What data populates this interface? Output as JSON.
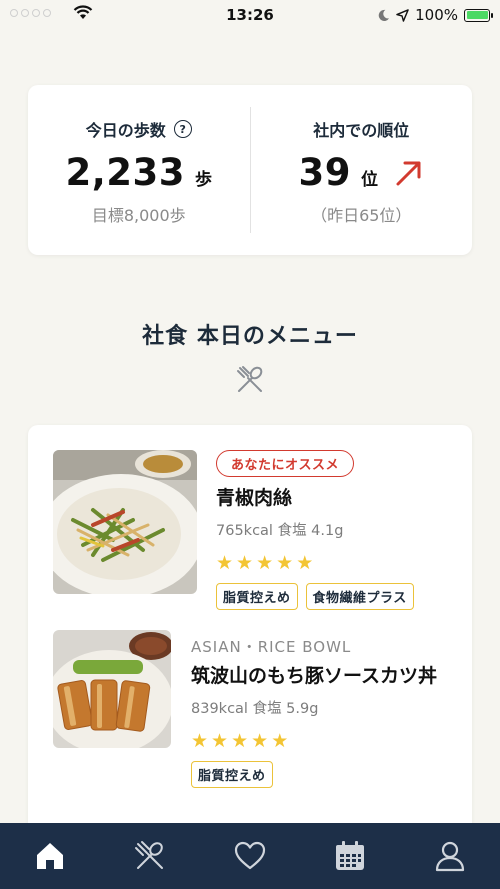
{
  "status_bar": {
    "time": "13:26",
    "battery_percent": "100%",
    "battery_level": 1.0,
    "icons": [
      "signal-dots",
      "wifi-icon",
      "moon-icon",
      "location-arrow-icon",
      "battery-icon"
    ]
  },
  "steps_card": {
    "today": {
      "label": "今日の歩数",
      "value": "2,233",
      "unit": "歩",
      "sub": "目標8,000歩",
      "help_icon": "?"
    },
    "rank": {
      "label": "社内での順位",
      "value": "39",
      "unit": "位",
      "sub": "（昨日65位）",
      "trend": "up",
      "trend_color": "#d23a2f"
    }
  },
  "menu_section": {
    "title": "社食 本日のメニュー",
    "icon": "utensils-icon"
  },
  "menu_items": [
    {
      "badge": "あなたにオススメ",
      "name": "青椒肉絲",
      "nutrition": "765kcal 食塩 4.1g",
      "rating": 5,
      "tags": [
        "脂質控えめ",
        "食物繊維プラス"
      ]
    },
    {
      "category": "ASIAN・RICE BOWL",
      "name": "筑波山のもち豚ソースカツ丼",
      "nutrition": "839kcal 食塩 5.9g",
      "rating": 5,
      "tags": [
        "脂質控えめ"
      ]
    }
  ],
  "tab_bar": {
    "tabs": [
      "home-icon",
      "utensils-icon",
      "heart-icon",
      "calendar-icon",
      "profile-icon"
    ],
    "active": "home-icon"
  },
  "colors": {
    "background": "#f6f5f0",
    "navy": "#1d2b3a",
    "tab_bar": "#1d2f48",
    "accent_red": "#d23a2f",
    "star": "#f3c534",
    "tag_border": "#ebc23a"
  }
}
